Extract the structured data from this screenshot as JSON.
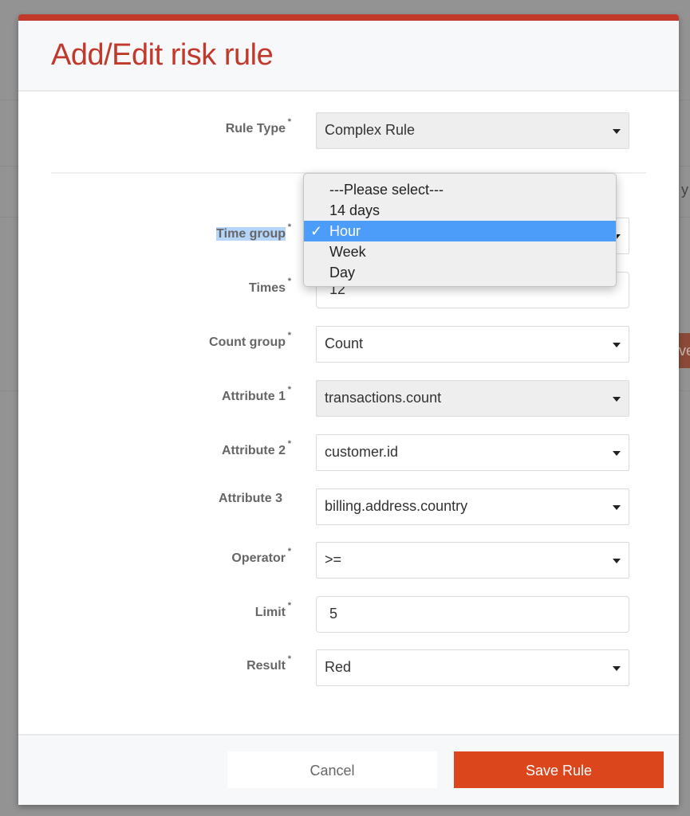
{
  "background": {
    "partial_text_1": "y",
    "partial_button": "ve"
  },
  "modal": {
    "title": "Add/Edit risk rule",
    "required_marker": "*",
    "rule_type": {
      "label": "Rule Type",
      "value": "Complex Rule"
    },
    "fields": [
      {
        "key": "time-group",
        "label": "Time group",
        "value": "Hour",
        "type": "select",
        "required": true,
        "grey": false,
        "highlighted": true
      },
      {
        "key": "times",
        "label": "Times",
        "value": "12",
        "type": "input",
        "required": true,
        "grey": false
      },
      {
        "key": "count-group",
        "label": "Count group",
        "value": "Count",
        "type": "select",
        "required": true,
        "grey": false
      },
      {
        "key": "attribute-1",
        "label": "Attribute 1",
        "value": "transactions.count",
        "type": "select",
        "required": true,
        "grey": true
      },
      {
        "key": "attribute-2",
        "label": "Attribute 2",
        "value": "customer.id",
        "type": "select",
        "required": true,
        "grey": false
      },
      {
        "key": "attribute-3",
        "label": "Attribute 3",
        "value": "billing.address.country",
        "type": "select",
        "required": false,
        "grey": false
      },
      {
        "key": "operator",
        "label": "Operator",
        "value": ">=",
        "type": "select",
        "required": true,
        "grey": false
      },
      {
        "key": "limit",
        "label": "Limit",
        "value": "5",
        "type": "input",
        "required": true,
        "grey": false
      },
      {
        "key": "result",
        "label": "Result",
        "value": "Red",
        "type": "select",
        "required": true,
        "grey": false
      }
    ],
    "time_group_dropdown": {
      "options": [
        "---Please select---",
        "14 days",
        "Hour",
        "Week",
        "Day"
      ],
      "selected": "Hour",
      "check_glyph": "✓"
    },
    "footer": {
      "cancel_label": "Cancel",
      "save_label": "Save Rule"
    }
  },
  "colors": {
    "accent": "#c0392b",
    "save_button": "#dc461d",
    "selected_option": "#4c9cf9"
  }
}
